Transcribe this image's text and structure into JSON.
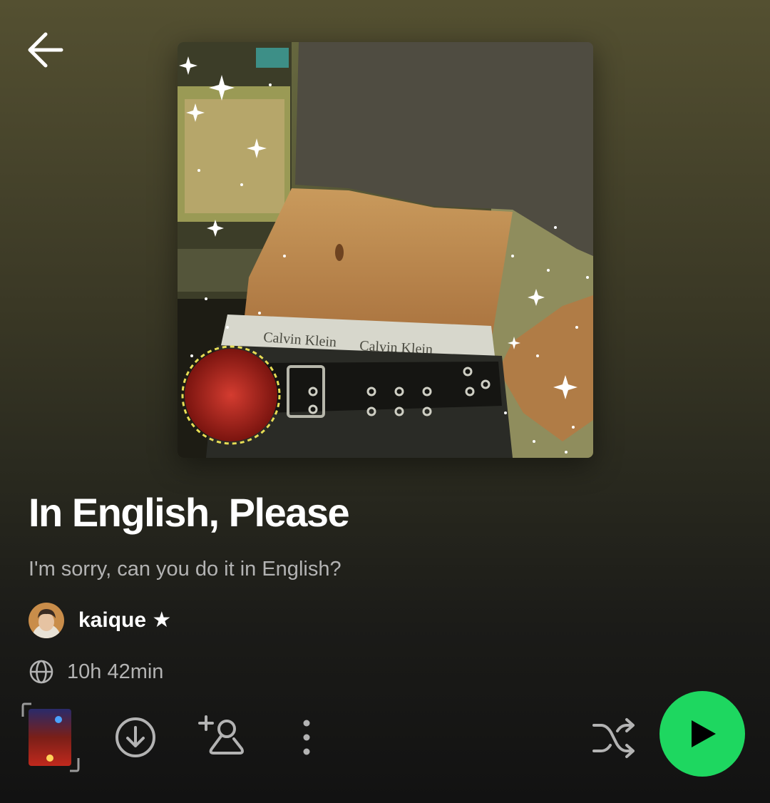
{
  "playlist": {
    "title": "In English, Please",
    "description": "I'm sorry, can you do it in English?",
    "owner": {
      "name": "kaique ★"
    },
    "duration": "10h 42min"
  },
  "cover_art": {
    "printed_text": [
      "Calvin Klein",
      "Calvin Klein"
    ]
  },
  "icons": {
    "back": "arrow-left-icon",
    "globe": "globe-icon",
    "download": "download-circle-icon",
    "follow": "add-person-icon",
    "more": "more-vertical-icon",
    "shuffle": "shuffle-icon",
    "play": "play-icon"
  },
  "colors": {
    "accent": "#1ed760",
    "header_tint": "#545031",
    "background": "#121212",
    "secondary_text": "#b3b3b3"
  }
}
